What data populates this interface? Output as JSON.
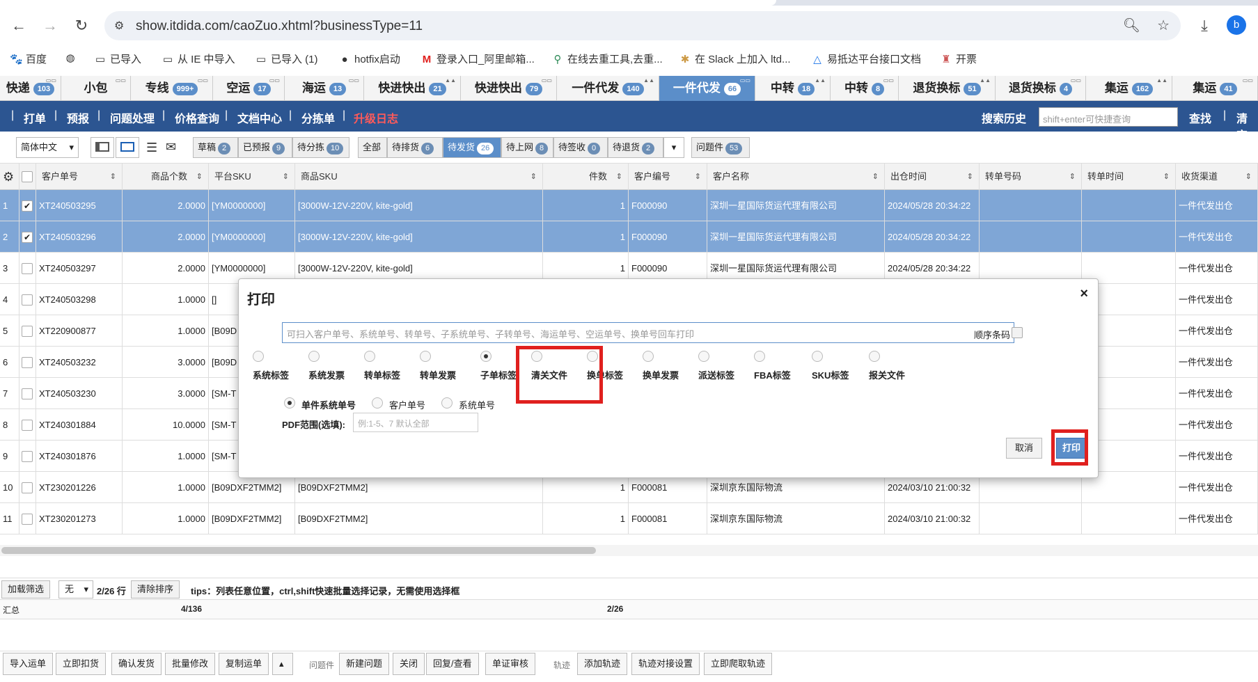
{
  "browser": {
    "url": "show.itdida.com/caoZuo.xhtml?businessType=11",
    "profile_initial": "b",
    "bookmarks": [
      "百度",
      "",
      "已导入",
      "从 IE 中导入",
      "已导入 (1)",
      "hotfix启动",
      "登录入口_阿里邮箱...",
      "在线去重工具,去重...",
      "在 Slack 上加入 ltd...",
      "易抵达平台接口文档",
      "开票"
    ]
  },
  "module_tabs": [
    {
      "label": "快递",
      "count": "103"
    },
    {
      "label": "小包",
      "count": ""
    },
    {
      "label": "专线",
      "count": "999+"
    },
    {
      "label": "空运",
      "count": "17"
    },
    {
      "label": "海运",
      "count": "13"
    },
    {
      "label": "快进快出",
      "count": "21"
    },
    {
      "label": "快进快出",
      "count": "79"
    },
    {
      "label": "一件代发",
      "count": "140"
    },
    {
      "label": "一件代发",
      "count": "66"
    },
    {
      "label": "中转",
      "count": "18"
    },
    {
      "label": "中转",
      "count": "8"
    },
    {
      "label": "退货换标",
      "count": "51"
    },
    {
      "label": "退货换标",
      "count": "4"
    },
    {
      "label": "集运",
      "count": "162"
    },
    {
      "label": "集运",
      "count": "41"
    }
  ],
  "menu": {
    "items": [
      "打单",
      "预报",
      "问题处理",
      "价格查询",
      "文档中心",
      "分拣单",
      "升级日志"
    ],
    "search_history": "搜索历史",
    "search_placeholder": "shift+enter可快捷查询",
    "find": "查找",
    "clear": "清空"
  },
  "filters": {
    "language": "简体中文",
    "group1": [
      {
        "label": "草稿",
        "count": "2"
      },
      {
        "label": "已预报",
        "count": "9"
      },
      {
        "label": "待分拣",
        "count": "10"
      }
    ],
    "group2": [
      {
        "label": "全部",
        "count": ""
      },
      {
        "label": "待排货",
        "count": "6"
      },
      {
        "label": "待发货",
        "count": "26"
      },
      {
        "label": "待上网",
        "count": "8"
      },
      {
        "label": "待签收",
        "count": "0"
      },
      {
        "label": "待退货",
        "count": "2"
      }
    ],
    "problem": {
      "label": "问题件",
      "count": "53"
    }
  },
  "table": {
    "columns": [
      "客户单号",
      "商品个数",
      "平台SKU",
      "商品SKU",
      "件数",
      "客户编号",
      "客户名称",
      "出仓时间",
      "转单号码",
      "转单时间",
      "收货渠道"
    ],
    "rows": [
      [
        "1",
        "XT240503295",
        "2.0000",
        "[YM0000000]",
        "[3000W-12V-220V, kite-gold]",
        "1",
        "F000090",
        "深圳一星国际货运代理有限公司",
        "2024/05/28 20:34:22",
        "",
        "",
        "一件代发出仓"
      ],
      [
        "2",
        "XT240503296",
        "2.0000",
        "[YM0000000]",
        "[3000W-12V-220V, kite-gold]",
        "1",
        "F000090",
        "深圳一星国际货运代理有限公司",
        "2024/05/28 20:34:22",
        "",
        "",
        "一件代发出仓"
      ],
      [
        "3",
        "XT240503297",
        "2.0000",
        "[YM0000000]",
        "[3000W-12V-220V, kite-gold]",
        "1",
        "F000090",
        "深圳一星国际货运代理有限公司",
        "2024/05/28 20:34:22",
        "",
        "",
        "一件代发出仓"
      ],
      [
        "4",
        "XT240503298",
        "1.0000",
        "[]",
        "",
        "",
        "",
        "",
        "",
        "",
        "",
        "一件代发出仓"
      ],
      [
        "5",
        "XT220900877",
        "1.0000",
        "[B09D",
        "",
        "",
        "",
        "",
        "",
        "",
        "",
        "一件代发出仓"
      ],
      [
        "6",
        "XT240503232",
        "3.0000",
        "[B09D",
        "",
        "",
        "",
        "",
        "",
        "",
        "",
        "一件代发出仓"
      ],
      [
        "7",
        "XT240503230",
        "3.0000",
        "[SM-T",
        "",
        "",
        "",
        "",
        "",
        "",
        "",
        "一件代发出仓"
      ],
      [
        "8",
        "XT240301884",
        "10.0000",
        "[SM-T",
        "",
        "",
        "",
        "",
        "",
        "",
        "",
        "一件代发出仓"
      ],
      [
        "9",
        "XT240301876",
        "1.0000",
        "[SM-T",
        "",
        "",
        "",
        "",
        "",
        "",
        "",
        "一件代发出仓"
      ],
      [
        "10",
        "XT230201226",
        "1.0000",
        "[B09DXF2TMM2]",
        "[B09DXF2TMM2]",
        "1",
        "F000081",
        "深圳京东国际物流",
        "2024/03/10 21:00:32",
        "",
        "",
        "一件代发出仓"
      ],
      [
        "11",
        "XT230201273",
        "1.0000",
        "[B09DXF2TMM2]",
        "[B09DXF2TMM2]",
        "1",
        "F000081",
        "深圳京东国际物流",
        "2024/03/10 21:00:32",
        "",
        "",
        "一件代发出仓"
      ]
    ],
    "selected_rows": [
      0,
      1
    ]
  },
  "tips": {
    "load_filter": "加载筛选",
    "filter_value": "无",
    "row_count": "2/26 行",
    "clear_sort": "清除排序",
    "tips_text": "tips：列表任意位置，ctrl,shift快速批量选择记录，无需使用选择框"
  },
  "summary": {
    "label": "汇总",
    "goods": "4/136",
    "pieces": "2/26"
  },
  "actions": {
    "group1": [
      "导入运单",
      "立即扣货",
      "确认发货",
      "批量修改",
      "复制运单"
    ],
    "problem_label": "问题件",
    "group2": [
      "新建问题",
      "关闭",
      "回复/查看",
      "单证审核"
    ],
    "track_label": "轨迹",
    "group3": [
      "添加轨迹",
      "轨迹对接设置",
      "立即爬取轨迹"
    ]
  },
  "dialog": {
    "title": "打印",
    "scan_placeholder": "可扫入客户单号、系统单号、转单号、子系统单号、子转单号、海运单号、空运单号、换单号回车打印",
    "order_barcode": "顺序条码",
    "options": [
      "系统标签",
      "系统发票",
      "转单标签",
      "转单发票",
      "子单标签",
      "清关文件",
      "换单标签",
      "换单发票",
      "派送标签",
      "FBA标签",
      "SKU标签",
      "报关文件"
    ],
    "selected_option": "子单标签",
    "number_types": [
      "单件系统单号",
      "客户单号",
      "系统单号"
    ],
    "selected_number_type": "单件系统单号",
    "pdf_range_label": "PDF范围(选填):",
    "pdf_range_placeholder": "例:1-5、7 默认全部",
    "cancel": "取消",
    "print": "打印"
  }
}
